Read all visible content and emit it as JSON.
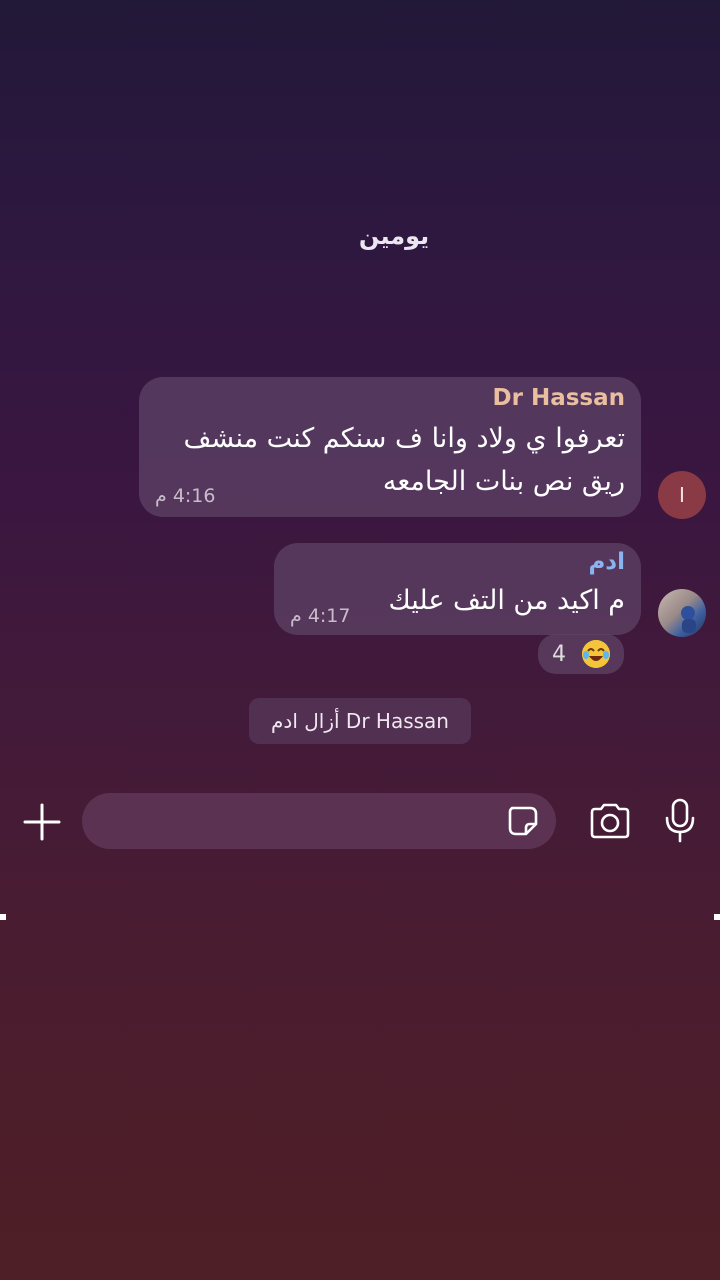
{
  "date_separator": "يومين",
  "messages": [
    {
      "sender": "Dr Hassan",
      "sender_color": "#e9bfa0",
      "lines": [
        "تعرفوا ي ولاد وانا ف سنكم كنت منشف",
        "ريق نص بنات الجامعه"
      ],
      "time": "4:16 م",
      "avatar_initial": "I",
      "avatar_color": "#8a3a44"
    },
    {
      "sender": "ادم",
      "sender_color": "#8ab4f0",
      "lines": [
        "م اكيد من التف عليك"
      ],
      "time": "4:17 م",
      "reaction": {
        "emoji": "joy-emoji",
        "count": "4"
      }
    }
  ],
  "system_note": "Dr Hassan أزال ادم",
  "composer": {
    "placeholder": "",
    "value": ""
  },
  "icons": {
    "plus": "plus-icon",
    "sticker": "sticker-icon",
    "camera": "camera-icon",
    "mic": "microphone-icon"
  }
}
